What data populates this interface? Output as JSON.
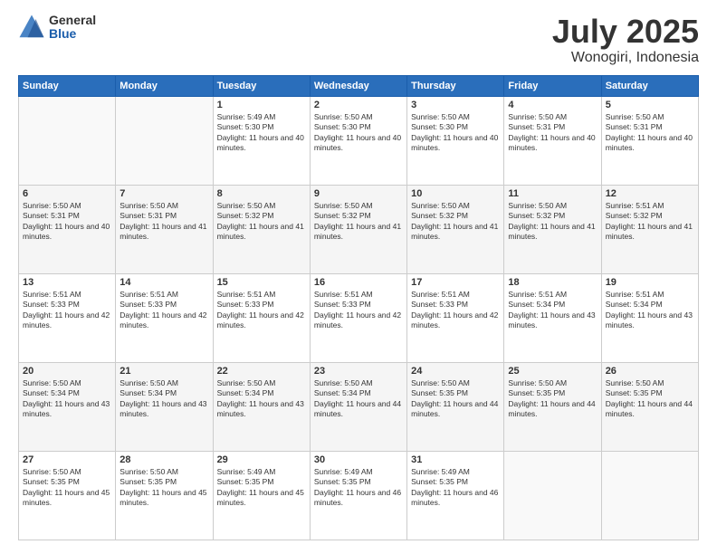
{
  "logo": {
    "general": "General",
    "blue": "Blue"
  },
  "title": {
    "month_year": "July 2025",
    "location": "Wonogiri, Indonesia"
  },
  "weekdays": [
    "Sunday",
    "Monday",
    "Tuesday",
    "Wednesday",
    "Thursday",
    "Friday",
    "Saturday"
  ],
  "weeks": [
    [
      {
        "day": "",
        "sunrise": "",
        "sunset": "",
        "daylight": ""
      },
      {
        "day": "",
        "sunrise": "",
        "sunset": "",
        "daylight": ""
      },
      {
        "day": "1",
        "sunrise": "Sunrise: 5:49 AM",
        "sunset": "Sunset: 5:30 PM",
        "daylight": "Daylight: 11 hours and 40 minutes."
      },
      {
        "day": "2",
        "sunrise": "Sunrise: 5:50 AM",
        "sunset": "Sunset: 5:30 PM",
        "daylight": "Daylight: 11 hours and 40 minutes."
      },
      {
        "day": "3",
        "sunrise": "Sunrise: 5:50 AM",
        "sunset": "Sunset: 5:30 PM",
        "daylight": "Daylight: 11 hours and 40 minutes."
      },
      {
        "day": "4",
        "sunrise": "Sunrise: 5:50 AM",
        "sunset": "Sunset: 5:31 PM",
        "daylight": "Daylight: 11 hours and 40 minutes."
      },
      {
        "day": "5",
        "sunrise": "Sunrise: 5:50 AM",
        "sunset": "Sunset: 5:31 PM",
        "daylight": "Daylight: 11 hours and 40 minutes."
      }
    ],
    [
      {
        "day": "6",
        "sunrise": "Sunrise: 5:50 AM",
        "sunset": "Sunset: 5:31 PM",
        "daylight": "Daylight: 11 hours and 40 minutes."
      },
      {
        "day": "7",
        "sunrise": "Sunrise: 5:50 AM",
        "sunset": "Sunset: 5:31 PM",
        "daylight": "Daylight: 11 hours and 41 minutes."
      },
      {
        "day": "8",
        "sunrise": "Sunrise: 5:50 AM",
        "sunset": "Sunset: 5:32 PM",
        "daylight": "Daylight: 11 hours and 41 minutes."
      },
      {
        "day": "9",
        "sunrise": "Sunrise: 5:50 AM",
        "sunset": "Sunset: 5:32 PM",
        "daylight": "Daylight: 11 hours and 41 minutes."
      },
      {
        "day": "10",
        "sunrise": "Sunrise: 5:50 AM",
        "sunset": "Sunset: 5:32 PM",
        "daylight": "Daylight: 11 hours and 41 minutes."
      },
      {
        "day": "11",
        "sunrise": "Sunrise: 5:50 AM",
        "sunset": "Sunset: 5:32 PM",
        "daylight": "Daylight: 11 hours and 41 minutes."
      },
      {
        "day": "12",
        "sunrise": "Sunrise: 5:51 AM",
        "sunset": "Sunset: 5:32 PM",
        "daylight": "Daylight: 11 hours and 41 minutes."
      }
    ],
    [
      {
        "day": "13",
        "sunrise": "Sunrise: 5:51 AM",
        "sunset": "Sunset: 5:33 PM",
        "daylight": "Daylight: 11 hours and 42 minutes."
      },
      {
        "day": "14",
        "sunrise": "Sunrise: 5:51 AM",
        "sunset": "Sunset: 5:33 PM",
        "daylight": "Daylight: 11 hours and 42 minutes."
      },
      {
        "day": "15",
        "sunrise": "Sunrise: 5:51 AM",
        "sunset": "Sunset: 5:33 PM",
        "daylight": "Daylight: 11 hours and 42 minutes."
      },
      {
        "day": "16",
        "sunrise": "Sunrise: 5:51 AM",
        "sunset": "Sunset: 5:33 PM",
        "daylight": "Daylight: 11 hours and 42 minutes."
      },
      {
        "day": "17",
        "sunrise": "Sunrise: 5:51 AM",
        "sunset": "Sunset: 5:33 PM",
        "daylight": "Daylight: 11 hours and 42 minutes."
      },
      {
        "day": "18",
        "sunrise": "Sunrise: 5:51 AM",
        "sunset": "Sunset: 5:34 PM",
        "daylight": "Daylight: 11 hours and 43 minutes."
      },
      {
        "day": "19",
        "sunrise": "Sunrise: 5:51 AM",
        "sunset": "Sunset: 5:34 PM",
        "daylight": "Daylight: 11 hours and 43 minutes."
      }
    ],
    [
      {
        "day": "20",
        "sunrise": "Sunrise: 5:50 AM",
        "sunset": "Sunset: 5:34 PM",
        "daylight": "Daylight: 11 hours and 43 minutes."
      },
      {
        "day": "21",
        "sunrise": "Sunrise: 5:50 AM",
        "sunset": "Sunset: 5:34 PM",
        "daylight": "Daylight: 11 hours and 43 minutes."
      },
      {
        "day": "22",
        "sunrise": "Sunrise: 5:50 AM",
        "sunset": "Sunset: 5:34 PM",
        "daylight": "Daylight: 11 hours and 43 minutes."
      },
      {
        "day": "23",
        "sunrise": "Sunrise: 5:50 AM",
        "sunset": "Sunset: 5:34 PM",
        "daylight": "Daylight: 11 hours and 44 minutes."
      },
      {
        "day": "24",
        "sunrise": "Sunrise: 5:50 AM",
        "sunset": "Sunset: 5:35 PM",
        "daylight": "Daylight: 11 hours and 44 minutes."
      },
      {
        "day": "25",
        "sunrise": "Sunrise: 5:50 AM",
        "sunset": "Sunset: 5:35 PM",
        "daylight": "Daylight: 11 hours and 44 minutes."
      },
      {
        "day": "26",
        "sunrise": "Sunrise: 5:50 AM",
        "sunset": "Sunset: 5:35 PM",
        "daylight": "Daylight: 11 hours and 44 minutes."
      }
    ],
    [
      {
        "day": "27",
        "sunrise": "Sunrise: 5:50 AM",
        "sunset": "Sunset: 5:35 PM",
        "daylight": "Daylight: 11 hours and 45 minutes."
      },
      {
        "day": "28",
        "sunrise": "Sunrise: 5:50 AM",
        "sunset": "Sunset: 5:35 PM",
        "daylight": "Daylight: 11 hours and 45 minutes."
      },
      {
        "day": "29",
        "sunrise": "Sunrise: 5:49 AM",
        "sunset": "Sunset: 5:35 PM",
        "daylight": "Daylight: 11 hours and 45 minutes."
      },
      {
        "day": "30",
        "sunrise": "Sunrise: 5:49 AM",
        "sunset": "Sunset: 5:35 PM",
        "daylight": "Daylight: 11 hours and 46 minutes."
      },
      {
        "day": "31",
        "sunrise": "Sunrise: 5:49 AM",
        "sunset": "Sunset: 5:35 PM",
        "daylight": "Daylight: 11 hours and 46 minutes."
      },
      {
        "day": "",
        "sunrise": "",
        "sunset": "",
        "daylight": ""
      },
      {
        "day": "",
        "sunrise": "",
        "sunset": "",
        "daylight": ""
      }
    ]
  ]
}
